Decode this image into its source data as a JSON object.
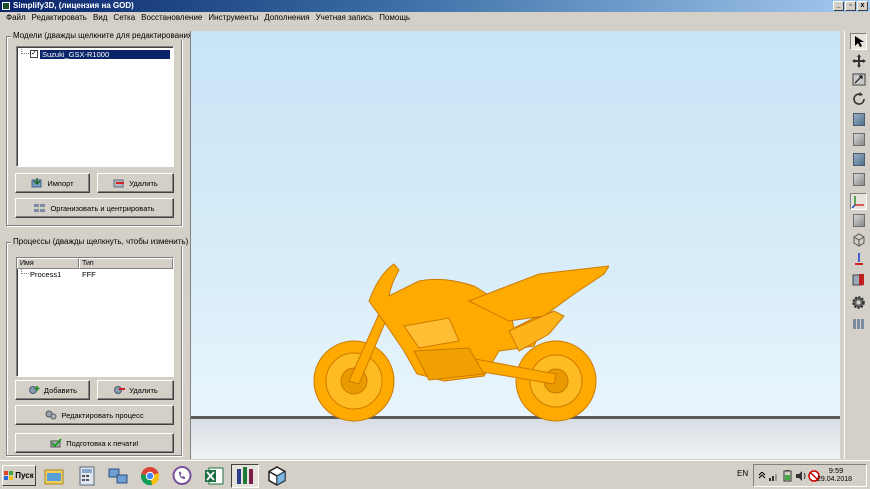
{
  "window": {
    "title": "Simplify3D, (лицензия на GOD)",
    "controls": {
      "minimize": "_",
      "restore": "▫",
      "close": "x"
    }
  },
  "menu": [
    "Файл",
    "Редактировать",
    "Вид",
    "Сетка",
    "Восстановление",
    "Инструменты",
    "Дополнения",
    "Учетная запись",
    "Помощь"
  ],
  "models": {
    "group_title": "Модели (дважды щелкните для редактирования)",
    "items": [
      {
        "label": "Suzuki_GSX-R1000",
        "checked": true,
        "selected": true
      }
    ],
    "import_label": "Импорт",
    "delete_label": "Удалить",
    "arrange_label": "Организовать и центрировать"
  },
  "processes": {
    "group_title": "Процессы (дважды щелкнуть, чтобы изменить)",
    "columns": [
      "Имя",
      "Тип"
    ],
    "rows": [
      {
        "name": "Process1",
        "type": "FFF"
      }
    ],
    "add_label": "Добавить",
    "delete_label": "Удалить",
    "edit_label": "Редактировать процесс",
    "prepare_label": "Подготовка к печати!"
  },
  "viewport": {
    "model_color": "#ffaa00",
    "floor_color": "#5a5a5a"
  },
  "right_toolbar": [
    "select-arrow-icon",
    "move-icon",
    "scale-icon",
    "rotate-icon",
    "view-front-cube-icon",
    "view-side-cube-icon",
    "view-top-cube-icon",
    "view-iso-cube-icon",
    "axes-icon",
    "solid-cube-icon",
    "wireframe-cube-icon",
    "tool-z-icon",
    "cross-section-icon",
    "settings-gear-icon",
    "columns-icon"
  ],
  "taskbar": {
    "start_label": "Пуск",
    "apps": [
      "file-manager-icon",
      "calculator-icon",
      "network-icon",
      "chrome-icon",
      "viber-icon",
      "excel-icon",
      "simplify3d-icon",
      "cube-app-icon"
    ],
    "language": "EN",
    "time": "9:59",
    "date": "29.04.2018"
  }
}
